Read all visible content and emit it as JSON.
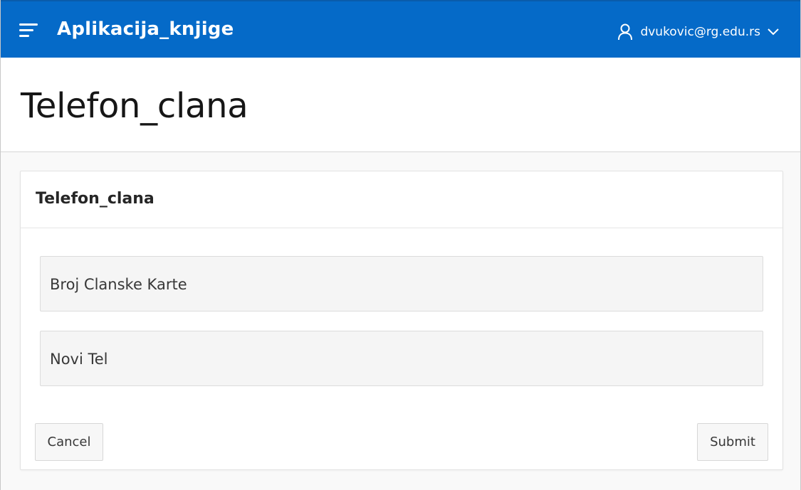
{
  "header": {
    "app_title": "Aplikacija_knjige",
    "user_name": "dvukovic@rg.edu.rs",
    "brand_color": "#056ac8",
    "icons": [
      "hamburger-menu-icon",
      "user-icon",
      "chevron-down-icon"
    ]
  },
  "page": {
    "title": "Telefon_clana"
  },
  "region": {
    "title": "Telefon_clana",
    "fields": [
      {
        "label": "Broj Clanske Karte",
        "value": ""
      },
      {
        "label": "Novi Tel",
        "value": ""
      }
    ]
  },
  "buttons": {
    "cancel_label": "Cancel",
    "submit_label": "Submit"
  }
}
